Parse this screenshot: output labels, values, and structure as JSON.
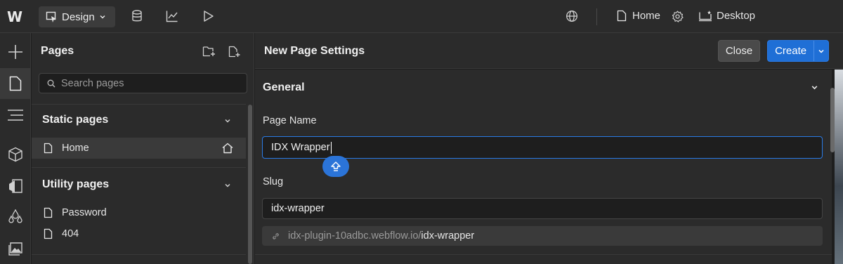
{
  "topbar": {
    "logo_text": "W",
    "mode_label": "Design",
    "current_page": "Home",
    "device_label": "Desktop",
    "icons": [
      "webflow-logo",
      "cursor-icon",
      "database-icon",
      "chart-icon",
      "play-icon",
      "globe-icon",
      "page-icon",
      "gear-icon",
      "desktop-icon"
    ]
  },
  "rail": {
    "icons": [
      "plus-icon",
      "page-icon",
      "navigator-icon",
      "box-icon",
      "style-icon",
      "drops-icon",
      "image-icon"
    ]
  },
  "pages_panel": {
    "title": "Pages",
    "search_placeholder": "Search pages",
    "static_section": {
      "title": "Static pages",
      "items": [
        {
          "label": "Home",
          "is_home": true,
          "selected": true
        }
      ]
    },
    "utility_section": {
      "title": "Utility pages",
      "items": [
        {
          "label": "Password"
        },
        {
          "label": "404"
        }
      ]
    }
  },
  "settings": {
    "title": "New Page Settings",
    "close_label": "Close",
    "create_label": "Create",
    "section_title": "General",
    "page_name_label": "Page Name",
    "page_name_value": "IDX Wrapper",
    "slug_label": "Slug",
    "slug_value": "idx-wrapper",
    "url_domain": "idx-plugin-10adbc.webflow.io/",
    "url_slug": "idx-wrapper"
  },
  "colors": {
    "accent": "#1f6fd6",
    "panel": "#2b2b2b",
    "background": "#1e1e1e"
  }
}
